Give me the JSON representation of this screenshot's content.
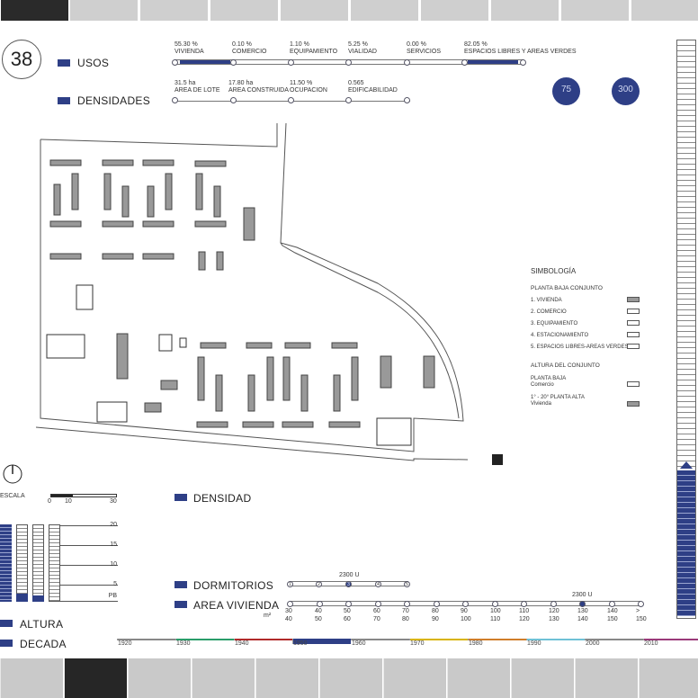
{
  "sheet_number": "38",
  "usos_label": "USOS",
  "densidades_label": "DENSIDADES",
  "usos": [
    {
      "value": "55.30 %",
      "label": "VIVIENDA"
    },
    {
      "value": "0.10 %",
      "label": "COMERCIO"
    },
    {
      "value": "1.10 %",
      "label": "EQUIPAMIENTO"
    },
    {
      "value": "5.25 %",
      "label": "VIALIDAD"
    },
    {
      "value": "0.00 %",
      "label": "SERVICIOS"
    },
    {
      "value": "82.05 %",
      "label": "ESPACIOS LIBRES Y AREAS VERDES"
    }
  ],
  "densidades": [
    {
      "value": "31.5 ha",
      "label": "AREA DE LOTE"
    },
    {
      "value": "17.80 ha",
      "label": "AREA CONSTRUIDA"
    },
    {
      "value": "11.50 %",
      "label": "OCUPACION"
    },
    {
      "value": "0.565",
      "label": "EDIFICABILIDAD"
    }
  ],
  "badges": [
    "75",
    "300"
  ],
  "simbologia": {
    "title": "SIMBOLOGÍA",
    "planta_title": "PLANTA BAJA CONJUNTO",
    "planta_items": [
      {
        "label": "1. VIVIENDA",
        "filled": true
      },
      {
        "label": "2. COMERCIO",
        "filled": false
      },
      {
        "label": "3. EQUIPAMIENTO",
        "filled": false
      },
      {
        "label": "4. ESTACIONAMIENTO",
        "filled": false
      },
      {
        "label": "5. ESPACIOS LIBRES-AREAS VERDES",
        "filled": false
      }
    ],
    "altura_title": "ALTURA DEL CONJUNTO",
    "altura_items": [
      {
        "label": "PLANTA BAJA\nComercio",
        "filled": false
      },
      {
        "label": "1° - 20° PLANTA ALTA\nVivienda",
        "filled": true
      }
    ]
  },
  "escala": {
    "label": "ESCALA",
    "ticks": [
      "0",
      "10",
      "30"
    ]
  },
  "densidad_label": "DENSIDAD",
  "altura_chart": {
    "ticks": [
      "20",
      "15",
      "10",
      "5",
      "PB"
    ]
  },
  "altura_label": "ALTURA",
  "decada_label": "DECADA",
  "dormitorios": {
    "label": "DORMITORIOS",
    "value": "2300 U",
    "steps": [
      "1",
      "2",
      "3",
      "4",
      "5"
    ],
    "selected": 2
  },
  "area_vivienda": {
    "label": "AREA VIVIENDA",
    "value": "2300 U",
    "unit": "m²",
    "top": [
      "30",
      "40",
      "50",
      "60",
      "70",
      "80",
      "90",
      "100",
      "110",
      "120",
      "130",
      "140",
      ">"
    ],
    "bottom": [
      "40",
      "50",
      "60",
      "70",
      "80",
      "90",
      "100",
      "110",
      "120",
      "130",
      "140",
      "150",
      "150"
    ],
    "selected": 10
  },
  "decadas": [
    "1920",
    "1930",
    "1940",
    "1950",
    "1960",
    "1970",
    "1980",
    "1990",
    "2000",
    "2010"
  ],
  "selected_decade": 3,
  "decade_colors": [
    "#888888",
    "#2a9d6a",
    "#b02a2a",
    "#2e3f86",
    "#888888",
    "#d8b400",
    "#cf7d2a",
    "#6fc1d6",
    "#888888",
    "#9a3a7a"
  ]
}
